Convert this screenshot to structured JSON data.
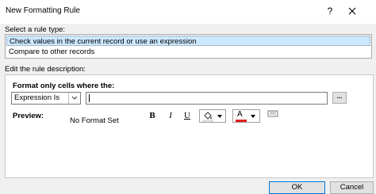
{
  "window": {
    "title": "New Formatting Rule",
    "help_label": "?"
  },
  "rule_type": {
    "label": "Select a rule type:",
    "items": [
      "Check values in the current record or use an expression",
      "Compare to other records"
    ]
  },
  "description": {
    "label": "Edit the rule description:",
    "format_label": "Format only cells where the:",
    "condition_selected": "Expression Is",
    "expression_value": "",
    "build_label": "..."
  },
  "preview": {
    "label": "Preview:",
    "text": "No Format Set",
    "bold_label": "B",
    "italic_label": "I",
    "underline_label": "U",
    "font_color_glyph": "A",
    "font_color": "#e01e1e"
  },
  "buttons": {
    "ok": "OK",
    "cancel": "Cancel"
  }
}
